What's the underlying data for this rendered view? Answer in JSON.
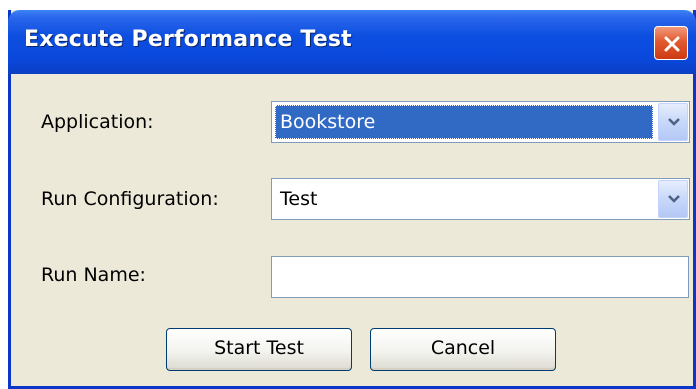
{
  "window": {
    "title": "Execute Performance Test"
  },
  "form": {
    "application": {
      "label": "Application:",
      "value": "Bookstore"
    },
    "run_configuration": {
      "label": "Run Configuration:",
      "value": "Test"
    },
    "run_name": {
      "label": "Run Name:",
      "value": ""
    }
  },
  "buttons": {
    "start_label": "Start Test",
    "cancel_label": "Cancel"
  },
  "icons": {
    "close": "close-icon",
    "dropdown": "chevron-down-icon"
  },
  "colors": {
    "titlebar": "#0a48dc",
    "selection": "#316ac5",
    "close_button": "#e2592f",
    "dialog_background": "#ece9d8"
  }
}
